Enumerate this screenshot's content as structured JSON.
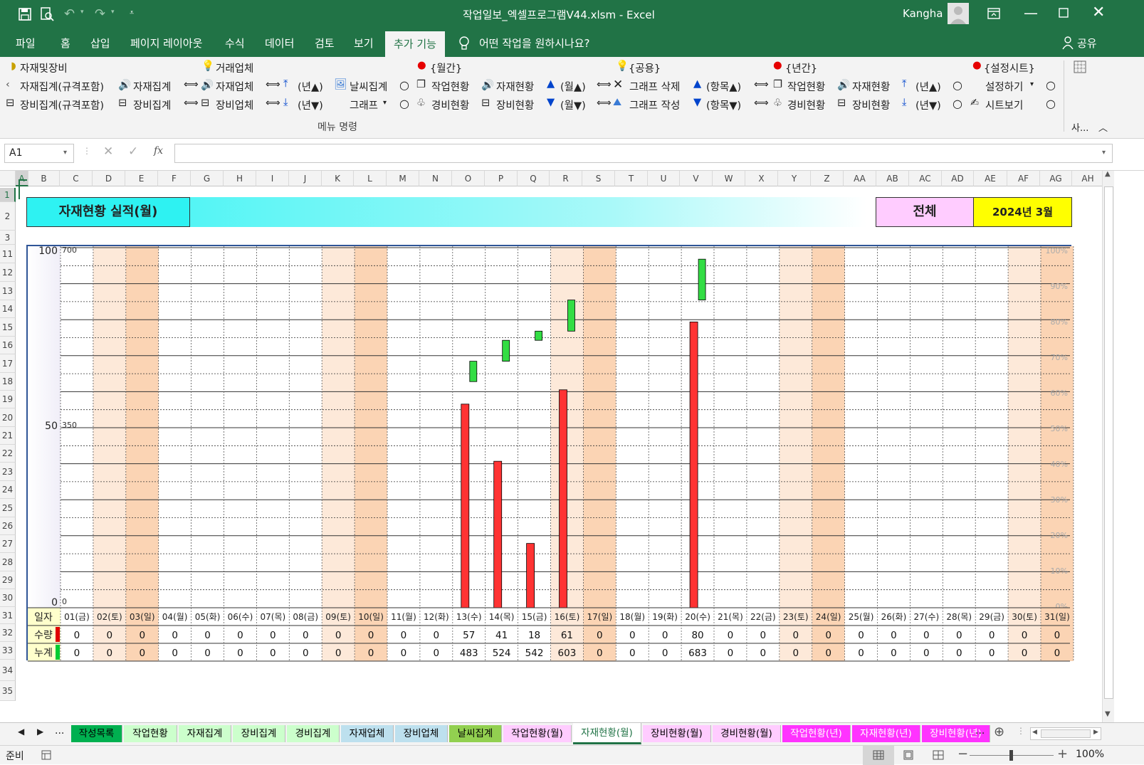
{
  "window": {
    "title": "작업일보_엑셀프로그램V44.xlsm  -  Excel",
    "user": "Kangha"
  },
  "menu_tabs": [
    "파일",
    "홈",
    "삽입",
    "페이지 레이아웃",
    "수식",
    "데이터",
    "검토",
    "보기",
    "추가 기능"
  ],
  "active_menu_tab": "추가 기능",
  "tell_me": "어떤 작업을 원하시나요?",
  "share": "공유",
  "ribbon": {
    "groups": {
      "g1": "자재및장비",
      "g2": "거래업체",
      "g3": "{월간}",
      "g4": "{공용}",
      "g5": "{년간}",
      "g6": "{설정시트}"
    },
    "row1": [
      "자재집계(규격포함)",
      "자재집계",
      "자재업체",
      "(년▲)",
      "날씨집계",
      "작업현황",
      "자재현황",
      "(월▲)",
      "그래프 삭제",
      "(항목▲)",
      "작업현황",
      "자재현황",
      "(년▲)",
      "설정하기"
    ],
    "row2": [
      "장비집계(규격포함)",
      "장비집계",
      "장비업체",
      "(년▼)",
      "그래프",
      "경비현황",
      "장비현황",
      "(월▼)",
      "그래프 작성",
      "(항목▼)",
      "경비현황",
      "장비현황",
      "(년▼)",
      "시트보기"
    ],
    "footer": "메뉴 명령",
    "right_label": "사..."
  },
  "formula_bar": {
    "name_box": "A1",
    "fx": "fx",
    "formula": ""
  },
  "columns": [
    "A",
    "B",
    "C",
    "D",
    "E",
    "F",
    "G",
    "H",
    "I",
    "J",
    "K",
    "L",
    "M",
    "N",
    "O",
    "P",
    "Q",
    "R",
    "S",
    "T",
    "U",
    "V",
    "W",
    "X",
    "Y",
    "Z",
    "AA",
    "AB",
    "AC",
    "AD",
    "AE",
    "AF",
    "AG",
    "AH"
  ],
  "rows": [
    "1",
    "2",
    "3",
    "11",
    "12",
    "13",
    "14",
    "15",
    "16",
    "17",
    "18",
    "19",
    "20",
    "21",
    "22",
    "23",
    "24",
    "25",
    "26",
    "27",
    "28",
    "29",
    "30",
    "31",
    "32",
    "33",
    "34",
    "35"
  ],
  "sheet": {
    "title": "자재현황 실적(월)",
    "scope": "전체",
    "period": "2024년 3월",
    "row_labels": {
      "day": "일자",
      "qty": "수량",
      "cum": "누계"
    }
  },
  "chart_data": {
    "type": "bar",
    "categories": [
      "01(금)",
      "02(토)",
      "03(일)",
      "04(월)",
      "05(화)",
      "06(수)",
      "07(목)",
      "08(금)",
      "09(토)",
      "10(일)",
      "11(월)",
      "12(화)",
      "13(수)",
      "14(목)",
      "15(금)",
      "16(토)",
      "17(일)",
      "18(월)",
      "19(화)",
      "20(수)",
      "21(목)",
      "22(금)",
      "23(토)",
      "24(일)",
      "25(월)",
      "26(화)",
      "27(수)",
      "28(목)",
      "29(금)",
      "30(토)",
      "31(일)"
    ],
    "weekend_flags": [
      0,
      1,
      2,
      0,
      0,
      0,
      0,
      0,
      1,
      2,
      0,
      0,
      0,
      0,
      0,
      1,
      2,
      0,
      0,
      0,
      0,
      0,
      1,
      2,
      0,
      0,
      0,
      0,
      0,
      1,
      2
    ],
    "series": [
      {
        "name": "수량",
        "color": "#ff3333",
        "values": [
          0,
          0,
          0,
          0,
          0,
          0,
          0,
          0,
          0,
          0,
          0,
          0,
          57,
          41,
          18,
          61,
          0,
          0,
          0,
          80,
          0,
          0,
          0,
          0,
          0,
          0,
          0,
          0,
          0,
          0,
          0
        ]
      },
      {
        "name": "누계",
        "color": "#33dd44",
        "values": [
          0,
          0,
          0,
          0,
          0,
          0,
          0,
          0,
          0,
          0,
          0,
          0,
          483,
          524,
          542,
          603,
          0,
          0,
          0,
          683,
          0,
          0,
          0,
          0,
          0,
          0,
          0,
          0,
          0,
          0,
          0
        ]
      }
    ],
    "left_axis": {
      "ticks": [
        "100",
        "50",
        "0"
      ],
      "range": [
        0,
        100
      ]
    },
    "inner_axis": {
      "ticks": [
        "700",
        "350",
        "0"
      ],
      "range": [
        0,
        700
      ]
    },
    "right_axis": {
      "ticks": [
        "100%",
        "90%",
        "80%",
        "70%",
        "60%",
        "50%",
        "40%",
        "30%",
        "20%",
        "10%",
        "0%"
      ]
    }
  },
  "sheet_tabs": [
    {
      "label": "작성목록",
      "bg": "#00b050",
      "fg": "#000"
    },
    {
      "label": "작업현황",
      "bg": "#ccffcc",
      "fg": "#000"
    },
    {
      "label": "자재집계",
      "bg": "#ccffcc",
      "fg": "#000"
    },
    {
      "label": "장비집계",
      "bg": "#ccffcc",
      "fg": "#000"
    },
    {
      "label": "경비집계",
      "bg": "#ccffcc",
      "fg": "#000"
    },
    {
      "label": "자재업체",
      "bg": "#bde0ee",
      "fg": "#000"
    },
    {
      "label": "장비업체",
      "bg": "#bde0ee",
      "fg": "#000"
    },
    {
      "label": "날씨집계",
      "bg": "#92d050",
      "fg": "#000"
    },
    {
      "label": "작업현황(월)",
      "bg": "#ffccff",
      "fg": "#000"
    },
    {
      "label": "자재현황(월)",
      "bg": "#ffffff",
      "fg": "#217346"
    },
    {
      "label": "장비현황(월)",
      "bg": "#ffccff",
      "fg": "#000"
    },
    {
      "label": "경비현황(월)",
      "bg": "#ffccff",
      "fg": "#000"
    },
    {
      "label": "작업현황(년)",
      "bg": "#ff33ff",
      "fg": "#fff"
    },
    {
      "label": "자재현황(년)",
      "bg": "#ff33ff",
      "fg": "#fff"
    },
    {
      "label": "장비현황(년)",
      "bg": "#ff33ff",
      "fg": "#fff"
    }
  ],
  "status": {
    "ready": "준비",
    "zoom": "100%"
  }
}
